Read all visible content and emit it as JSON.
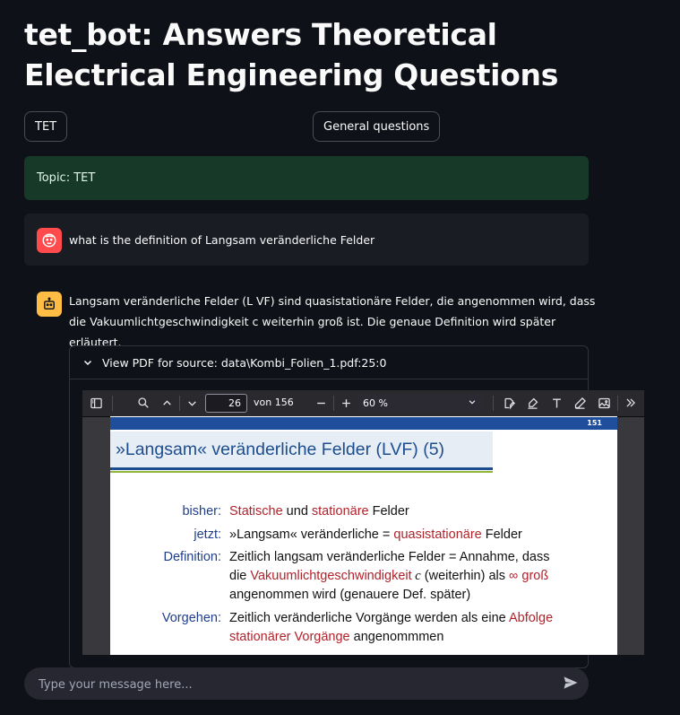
{
  "title": "tet_bot: Answers Theoretical Electrical Engineering Questions",
  "buttons": {
    "tet": "TET",
    "general": "General questions"
  },
  "topic": "Topic: TET",
  "user_message": "what is the definition of Langsam veränderliche Felder",
  "bot_message": "Langsam veränderliche Felder (L VF) sind quasistationäre Felder, die angenommen wird, dass die Vakuumlichtgeschwindigkeit c weiterhin groß ist. Die genaue Definition wird später erläutert.",
  "expander": {
    "label": "View PDF for source: data\\Kombi_Folien_1.pdf:25:0"
  },
  "pdf_viewer": {
    "page_value": "26",
    "page_count": "von 156",
    "zoom": "60 %",
    "page_label": "151",
    "slide_title": "»Langsam« veränderliche Felder (LVF)  (5)",
    "rows": {
      "bisher_label": "bisher:",
      "bisher_a": "Statische",
      "bisher_b": " und ",
      "bisher_c": "stationäre",
      "bisher_d": " Felder",
      "jetzt_label": "jetzt:",
      "jetzt_a": "»Langsam« veränderliche = ",
      "jetzt_b": "quasistationäre",
      "jetzt_c": " Felder",
      "def_label": "Definition:",
      "def_line1": "Zeitlich langsam veränderliche Felder = Annahme, dass",
      "def_line2_a": "die ",
      "def_line2_b": "Vakuumlichtgeschwindigkeit",
      "def_line2_c": " c",
      "def_line2_d": " (weiterhin) als ",
      "def_line2_e": "∞ groß",
      "def_line3": "angenommen wird (genauere Def. später)",
      "vorg_label": "Vorgehen:",
      "vorg_line1_a": "Zeitlich veränderliche Vorgänge werden als eine ",
      "vorg_line1_b": "Abfolge",
      "vorg_line2_a": "stationärer Vorgänge",
      "vorg_line2_b": " angenommmen"
    }
  },
  "chat_input": {
    "placeholder": "Type your message here..."
  },
  "colors": {
    "background": "#0e1117",
    "topic_bg": "#173928",
    "user_avatar": "#ff4b4b",
    "bot_avatar": "#ffbd45",
    "slide_blue": "#1c4d8f",
    "slide_red": "#b2222b"
  },
  "icons": [
    "user-avatar-icon",
    "bot-avatar-icon",
    "chevron-down-icon",
    "sidebar-toggle-icon",
    "search-icon",
    "chevron-up-icon",
    "zoom-out-icon",
    "zoom-in-icon",
    "signature-icon",
    "highlight-icon",
    "text-icon",
    "draw-icon",
    "image-icon",
    "more-tools-icon",
    "send-icon"
  ]
}
